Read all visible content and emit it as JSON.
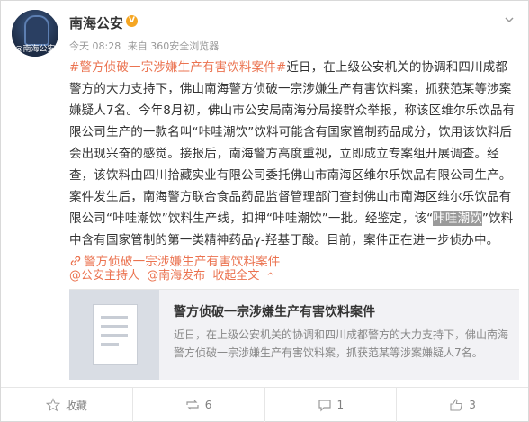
{
  "post": {
    "username": "南海公安",
    "verified_badge": "V",
    "avatar_text": "@南海公安",
    "time": "今天 08:28",
    "source": "来自 360安全浏览器",
    "topic_tag": "#警方侦破一宗涉嫌生产有害饮料案件#",
    "body_1": "近日，在上级公安机关的协调和四川成都警方的大力支持下，佛山南海警方侦破一宗涉嫌生产有害饮料案，抓获范某等涉案嫌疑人7名。今年8月初，佛山市公安局南海分局接群众举报，称该区维尔乐饮品有限公司生产的一款名叫“咔哇潮饮”饮料可能含有国家管制药品成分，饮用该饮料后会出现兴奋的感觉。接报后，南海警方高度重视，立即成立专案组开展调查。经查，该饮料由四川拾藏实业有限公司委托佛山市南海区维尔乐饮品有限公司生产。案件发生后，南海警方联合食品药品监督管理部门查封佛山市南海区维尔乐饮品有限公司“咔哇潮饮”饮料生产线，扣押“咔哇潮饮”一批。经鉴定，该“",
    "body_highlight": "咔哇潮饮",
    "body_2": "”饮料中含有国家管制的第一类精神药品γ-羟基丁酸。目前，案件正在进一步侦办中。",
    "article_link": "警方侦破一宗涉嫌生产有害饮料案件",
    "mention_1": "@公安主持人",
    "mention_2": "@南海发布",
    "show_full": "收起全文",
    "show_full_chev": "^"
  },
  "preview": {
    "title": "警方侦破一宗涉嫌生产有害饮料案件",
    "desc": "近日，在上级公安机关的协调和四川成都警方的大力支持下，佛山南海警方侦破一宗涉嫌生产有害饮料案，抓获范某等涉案嫌疑人7名。"
  },
  "actions": {
    "favorite": "收藏",
    "repost": "6",
    "comment": "1",
    "like": "3"
  },
  "colors": {
    "accent": "#eb7350",
    "verified": "#f5a623",
    "muted": "#999999"
  }
}
